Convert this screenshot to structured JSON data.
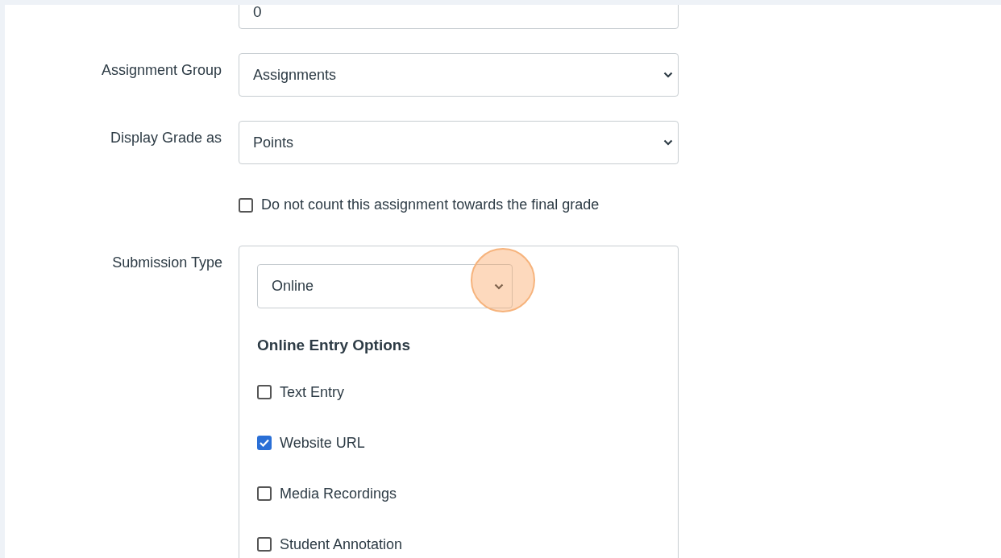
{
  "points_field": {
    "value": "0"
  },
  "fields": [
    {
      "label": "Assignment Group",
      "value": "Assignments"
    },
    {
      "label": "Display Grade as",
      "value": "Points"
    }
  ],
  "exclude_checkbox": {
    "label": "Do not count this assignment towards the final grade",
    "checked": false
  },
  "submission_type": {
    "label": "Submission Type",
    "value": "Online",
    "highlighted": true,
    "options_heading": "Online Entry Options",
    "options": [
      {
        "label": "Text Entry",
        "checked": false
      },
      {
        "label": "Website URL",
        "checked": true
      },
      {
        "label": "Media Recordings",
        "checked": false
      },
      {
        "label": "Student Annotation",
        "checked": false
      }
    ]
  }
}
